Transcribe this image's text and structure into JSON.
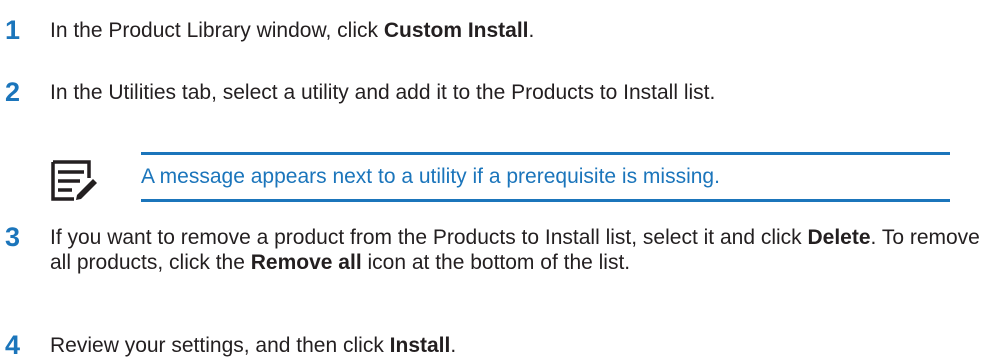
{
  "steps": [
    {
      "number": "1",
      "parts": [
        "In the Product Library window, click ",
        "Custom Install",
        "."
      ]
    },
    {
      "number": "2",
      "text": "In the Utilities tab, select a utility and add it to the Products to Install list."
    },
    {
      "number": "3",
      "parts": [
        "If you want to remove a product from the Products to Install list, select it and click ",
        "Delete",
        ". To remove all products, click the ",
        "Remove all",
        " icon at the bottom of the list."
      ]
    },
    {
      "number": "4",
      "parts": [
        "Review your settings, and then click ",
        "Install",
        "."
      ]
    }
  ],
  "note": {
    "icon": "note-pencil-icon",
    "text": "A message appears next to a utility if a prerequisite is missing."
  },
  "colors": {
    "accent": "#1b75bb",
    "text": "#231f20"
  }
}
